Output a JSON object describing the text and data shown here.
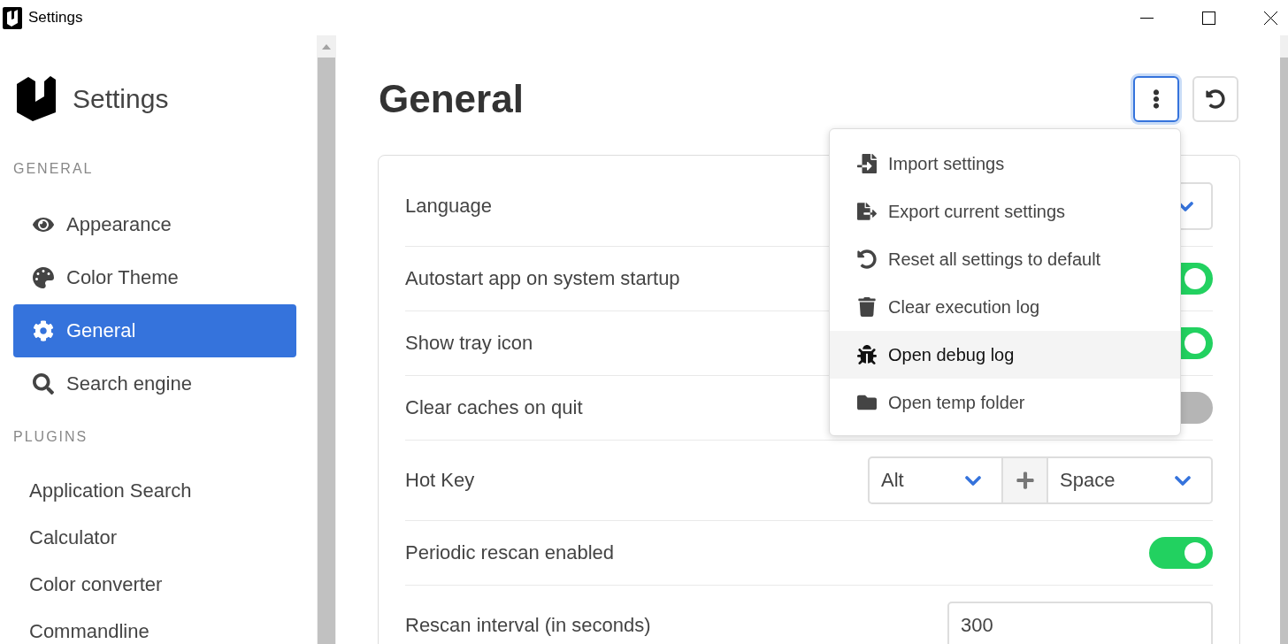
{
  "window": {
    "title": "Settings"
  },
  "sidebar": {
    "title": "Settings",
    "sections": [
      {
        "label": "GENERAL",
        "items": [
          {
            "label": "Appearance",
            "selected": false
          },
          {
            "label": "Color Theme",
            "selected": false
          },
          {
            "label": "General",
            "selected": true
          },
          {
            "label": "Search engine",
            "selected": false
          }
        ]
      },
      {
        "label": "PLUGINS",
        "items": [
          {
            "label": "Application Search",
            "selected": false
          },
          {
            "label": "Calculator",
            "selected": false
          },
          {
            "label": "Color converter",
            "selected": false
          },
          {
            "label": "Commandline",
            "selected": false
          }
        ]
      }
    ]
  },
  "page": {
    "title": "General",
    "menu_button": {
      "open": true
    },
    "menu": {
      "items": [
        {
          "label": "Import settings",
          "highlighted": false
        },
        {
          "label": "Export current settings",
          "highlighted": false
        },
        {
          "label": "Reset all settings to default",
          "highlighted": false
        },
        {
          "label": "Clear execution log",
          "highlighted": false
        },
        {
          "label": "Open debug log",
          "highlighted": true
        },
        {
          "label": "Open temp folder",
          "highlighted": false
        }
      ]
    }
  },
  "settings": [
    {
      "kind": "select",
      "label": "Language"
    },
    {
      "kind": "toggle",
      "label": "Autostart app on system startup",
      "on": true
    },
    {
      "kind": "toggle",
      "label": "Show tray icon",
      "on": true
    },
    {
      "kind": "toggle",
      "label": "Clear caches on quit",
      "on": false
    },
    {
      "kind": "hotkey",
      "label": "Hot Key",
      "modifier": "Alt",
      "key": "Space"
    },
    {
      "kind": "toggle",
      "label": "Periodic rescan enabled",
      "on": true
    },
    {
      "kind": "number",
      "label": "Rescan interval (in seconds)",
      "value": "300"
    }
  ]
}
